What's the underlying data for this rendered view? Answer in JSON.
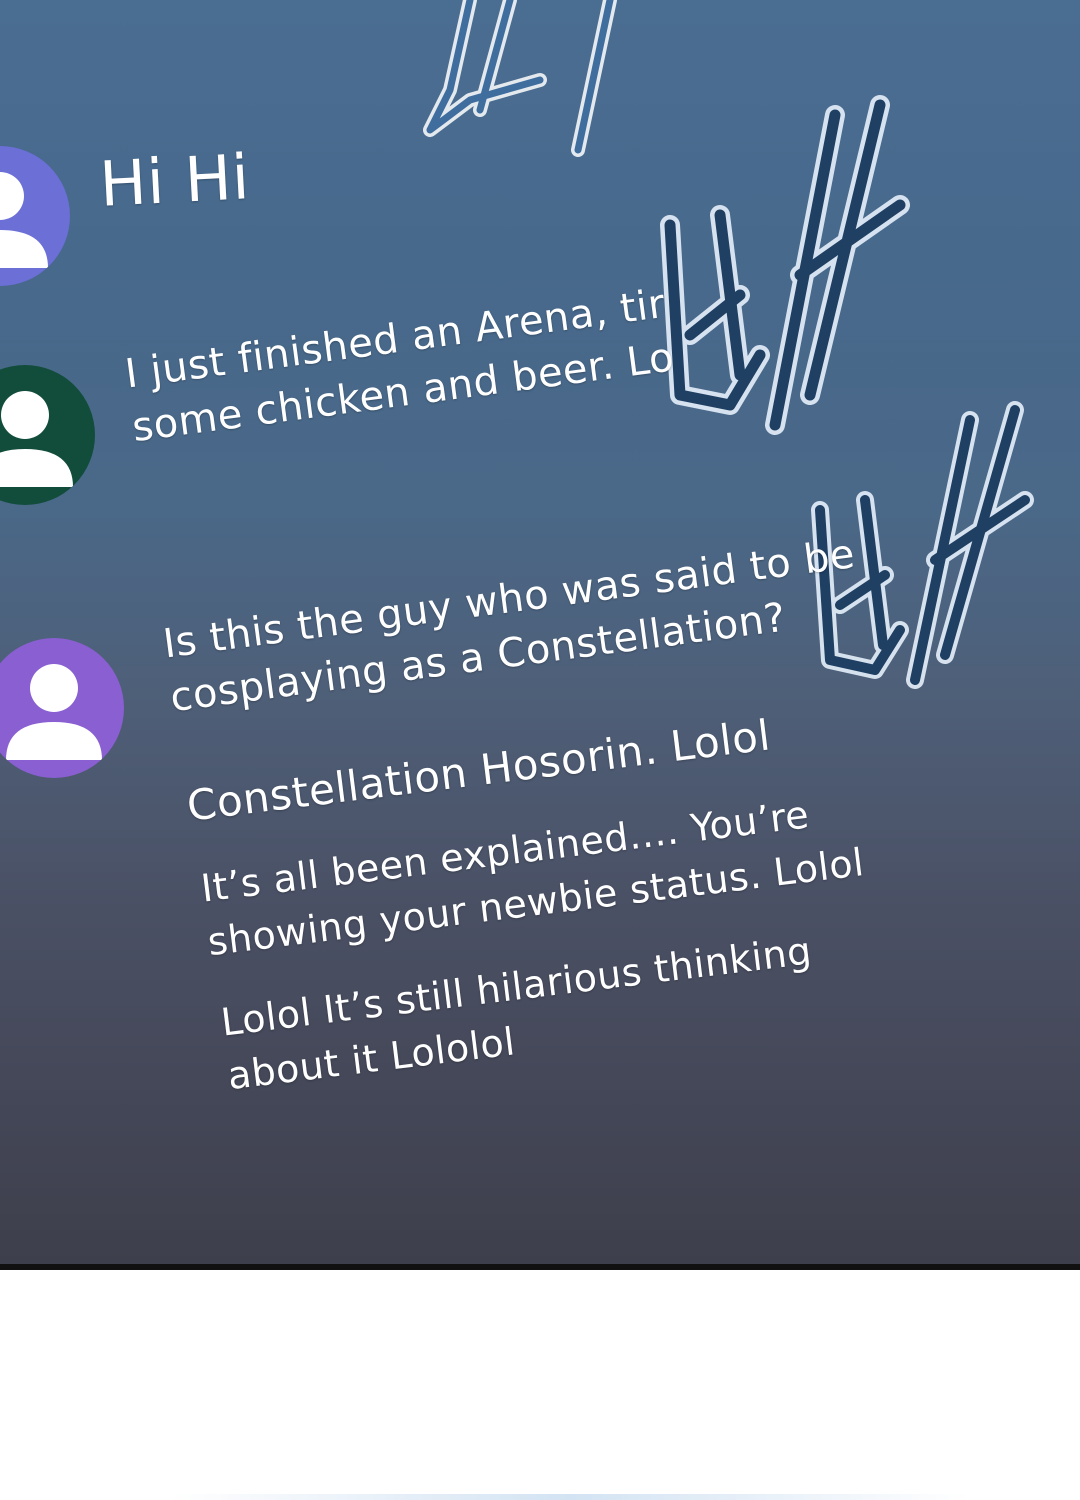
{
  "chat": {
    "messages": [
      {
        "avatar_color": "#6b6fd6",
        "lines": [
          "Hi Hi"
        ]
      },
      {
        "avatar_color": "#114d3a",
        "lines": [
          "I just finished an Arena, tir",
          "some chicken and beer. Lo"
        ]
      },
      {
        "avatar_color": "#8a5fd1",
        "lines": [
          "Is this the guy who was said to be",
          "cosplaying as a Constellation?"
        ]
      },
      {
        "lines": [
          "Constellation Hosorin. Lolol"
        ]
      },
      {
        "lines": [
          "It’s all been explained.... You’re",
          "showing your newbie status. Lolol"
        ]
      },
      {
        "lines": [
          "Lolol It’s still hilarious thinking",
          "about it Lololol"
        ]
      }
    ]
  },
  "sfx": [
    {
      "glyph": "팍",
      "color": "#3f6d9e"
    },
    {
      "glyph": "바",
      "color": "#2c5684"
    },
    {
      "glyph": "바",
      "color": "#2c5684"
    }
  ],
  "colors": {
    "panel_top": "#4a6d92",
    "panel_bottom": "#3e3f4c",
    "text": "#ffffff",
    "avatar_figure": "#ffffff"
  },
  "icons": [
    "user-avatar-icon",
    "user-avatar-icon",
    "user-avatar-icon"
  ]
}
